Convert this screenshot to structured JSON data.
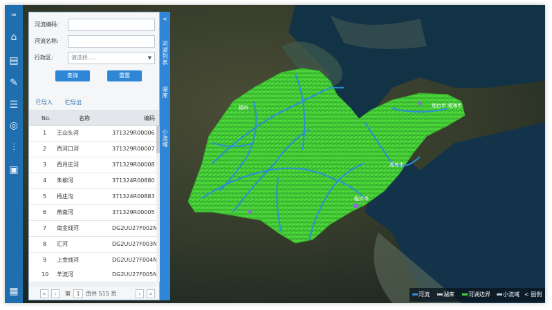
{
  "form": {
    "code_label": "河流编码:",
    "name_label": "河流名称:",
    "region_label": "行政区:",
    "region_placeholder": "请选择.....",
    "query_button": "查询",
    "reset_button": "重置"
  },
  "toolbar": {
    "import": "导入",
    "export": "导出"
  },
  "table": {
    "columns": [
      "No.",
      "名称",
      "编码"
    ],
    "rows": [
      {
        "no": "1",
        "name": "王山头河",
        "code": "371329R00006"
      },
      {
        "no": "2",
        "name": "西河口河",
        "code": "371329R00007"
      },
      {
        "no": "3",
        "name": "西月庄河",
        "code": "371329R00008"
      },
      {
        "no": "4",
        "name": "朱柳河",
        "code": "371324R00880"
      },
      {
        "no": "5",
        "name": "杨庄沟",
        "code": "371324R00883"
      },
      {
        "no": "6",
        "name": "燕南河",
        "code": "371329R00005"
      },
      {
        "no": "7",
        "name": "南金线河",
        "code": "DG2UU27F002N"
      },
      {
        "no": "8",
        "name": "汇河",
        "code": "DG2UU27F003N"
      },
      {
        "no": "9",
        "name": "上金线河",
        "code": "DG2UU27F004N"
      },
      {
        "no": "10",
        "name": "羊流河",
        "code": "DG2UU27F005N"
      }
    ]
  },
  "pager": {
    "page_label": "第",
    "page_value": "1",
    "total": "页共 515 页"
  },
  "side_tabs": {
    "collapse": "<",
    "tab1": "河湖列表",
    "tab2": "湖库",
    "tab3": "小流域"
  },
  "legend": {
    "items": [
      {
        "label": "河流",
        "color": "#2f8fe0"
      },
      {
        "label": "湖库",
        "color": "#c9ced4"
      },
      {
        "label": "河湖边界",
        "color": "#49d83a"
      },
      {
        "label": "小流域",
        "color": "#c9ced4"
      }
    ],
    "toggle": "< 图例"
  },
  "map_labels": [
    "德州",
    "烟台市",
    "青岛市",
    "临沂市",
    "威海市"
  ]
}
